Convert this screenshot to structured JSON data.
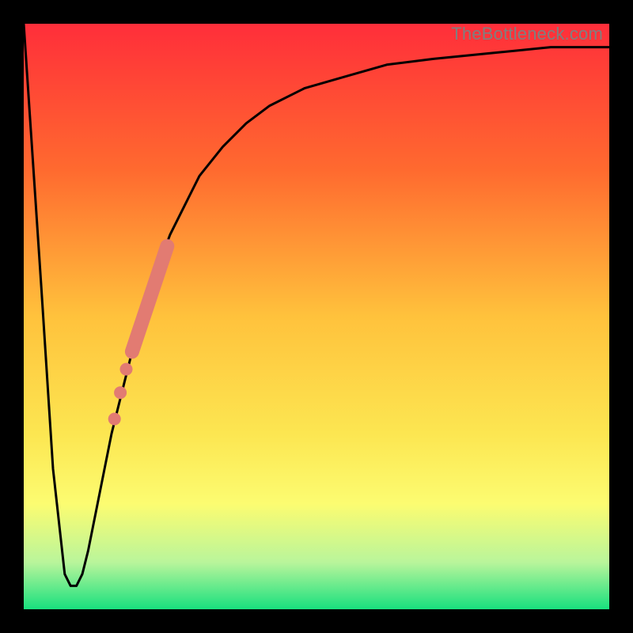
{
  "watermark": "TheBottleneck.com",
  "chart_data": {
    "type": "line",
    "title": "",
    "xlabel": "",
    "ylabel": "",
    "xlim": [
      0,
      100
    ],
    "ylim": [
      0,
      100
    ],
    "background_gradient": {
      "stops": [
        {
          "offset": 0.0,
          "color": "#ff2e3a"
        },
        {
          "offset": 0.25,
          "color": "#ff6a2f"
        },
        {
          "offset": 0.5,
          "color": "#ffc23c"
        },
        {
          "offset": 0.7,
          "color": "#fce651"
        },
        {
          "offset": 0.82,
          "color": "#fcfc71"
        },
        {
          "offset": 0.92,
          "color": "#b9f59b"
        },
        {
          "offset": 1.0,
          "color": "#18e07e"
        }
      ]
    },
    "series": [
      {
        "name": "bottleneck-curve",
        "color": "#000000",
        "x": [
          0,
          3,
          5,
          7,
          8,
          9,
          10,
          11,
          13,
          15,
          18,
          20,
          22,
          25,
          28,
          30,
          34,
          38,
          42,
          48,
          55,
          62,
          70,
          80,
          90,
          100
        ],
        "y": [
          100,
          55,
          24,
          6,
          4,
          4,
          6,
          10,
          20,
          30,
          42,
          50,
          56,
          64,
          70,
          74,
          79,
          83,
          86,
          89,
          91,
          93,
          94,
          95,
          96,
          96
        ]
      }
    ],
    "markers": [
      {
        "name": "highlight-segment",
        "color": "#e27b72",
        "shape": "round",
        "thickness": 18,
        "x": [
          18.5,
          24.5
        ],
        "y": [
          44,
          62
        ]
      },
      {
        "name": "highlight-dots",
        "color": "#e27b72",
        "shape": "circle",
        "radius": 8,
        "points": [
          {
            "x": 17.5,
            "y": 41
          },
          {
            "x": 16.5,
            "y": 37
          },
          {
            "x": 15.5,
            "y": 32.5
          }
        ]
      }
    ]
  }
}
